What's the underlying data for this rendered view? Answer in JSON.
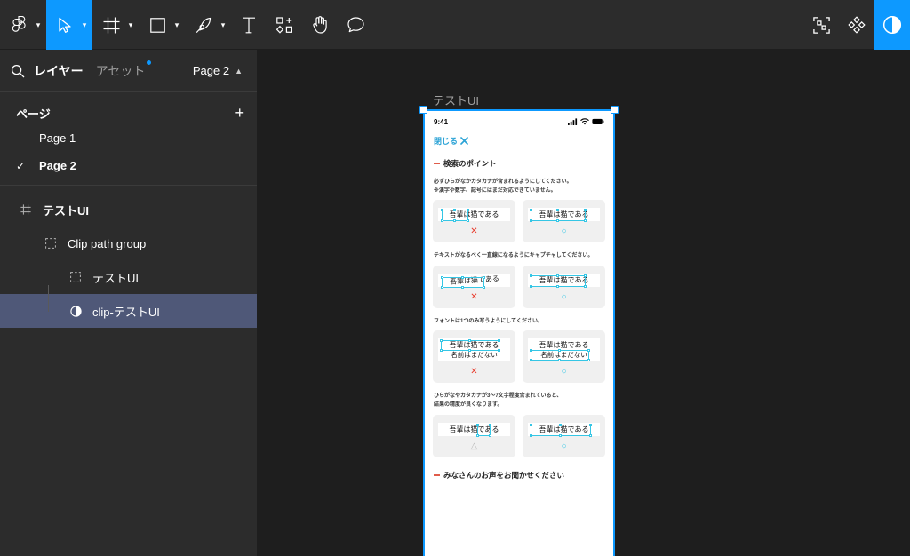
{
  "toolbar": {
    "tools": [
      {
        "name": "figma-logo-icon",
        "label": "Figma",
        "has_caret": true,
        "active": false
      },
      {
        "name": "move-tool-icon",
        "label": "移動",
        "has_caret": true,
        "active": true
      },
      {
        "name": "frame-tool-icon",
        "label": "フレーム",
        "has_caret": true,
        "active": false
      },
      {
        "name": "shape-tool-icon",
        "label": "シェイプ",
        "has_caret": true,
        "active": false
      },
      {
        "name": "pen-tool-icon",
        "label": "ペン",
        "has_caret": true,
        "active": false
      },
      {
        "name": "text-tool-icon",
        "label": "テキスト",
        "has_caret": false,
        "active": false
      },
      {
        "name": "components-tool-icon",
        "label": "コンポーネント",
        "has_caret": false,
        "active": false
      },
      {
        "name": "hand-tool-icon",
        "label": "手のひら",
        "has_caret": false,
        "active": false
      },
      {
        "name": "comment-tool-icon",
        "label": "コメント",
        "has_caret": false,
        "active": false
      }
    ],
    "right_tools": [
      {
        "name": "dev-mode-icon",
        "label": "開発モード",
        "active": false
      },
      {
        "name": "plugins-icon",
        "label": "プラグイン",
        "active": false
      },
      {
        "name": "appearance-icon",
        "label": "表示切替",
        "active": true
      }
    ]
  },
  "sidebar": {
    "search_icon": "search-icon",
    "tabs": [
      {
        "label": "レイヤー",
        "active": true,
        "badge": false
      },
      {
        "label": "アセット",
        "active": false,
        "badge": true
      }
    ],
    "page_selector": {
      "label": "Page 2",
      "chevron": "chevron-up-icon"
    },
    "pages_section": {
      "title": "ページ",
      "add_label": "+",
      "items": [
        {
          "label": "Page 1",
          "selected": false
        },
        {
          "label": "Page 2",
          "selected": true
        }
      ]
    },
    "layers": [
      {
        "label": "テストUI",
        "icon": "frame-icon",
        "indent": 0,
        "selected": false,
        "bold": true
      },
      {
        "label": "Clip path group",
        "icon": "group-icon",
        "indent": 1,
        "selected": false,
        "bold": false
      },
      {
        "label": "テストUI",
        "icon": "group-icon",
        "indent": 2,
        "selected": false,
        "bold": false
      },
      {
        "label": "clip-テストUI",
        "icon": "boolean-icon",
        "indent": 2,
        "selected": true,
        "bold": false
      }
    ]
  },
  "canvas": {
    "frame_title": "テストUI",
    "artboard": {
      "status_bar": {
        "time": "9:41",
        "signal_icon": "cellular-signal-icon",
        "wifi_icon": "wifi-icon",
        "battery_icon": "battery-icon"
      },
      "close_button": {
        "label": "閉じる",
        "icon": "close-icon"
      },
      "section_title": "検索のポイント",
      "sections": [
        {
          "description": "必ずひらがなかカタカナが含まれるようにしてください。\n※漢字や数字、記号にはまだ対応できていません。",
          "cards": [
            {
              "lines": [
                "吾輩は猫である"
              ],
              "verdict": "✕",
              "verdict_type": "ng",
              "style": "normal",
              "sel_width": 52
            },
            {
              "lines": [
                "吾輩は猫である"
              ],
              "verdict": "○",
              "verdict_type": "ok",
              "style": "normal",
              "sel_width": 62
            }
          ]
        },
        {
          "description": "テキストがなるべく一直線になるようにキャプチャしてください。",
          "cards": [
            {
              "lines": [
                "吾輩は猫である"
              ],
              "verdict": "✕",
              "verdict_type": "ng",
              "style": "skew",
              "sel_width": 52
            },
            {
              "lines": [
                "吾輩は猫である"
              ],
              "verdict": "○",
              "verdict_type": "ok",
              "style": "normal",
              "sel_width": 62
            }
          ]
        },
        {
          "description": "フォントは1つのみ写うようにしてください。",
          "cards": [
            {
              "lines": [
                "吾輩は猫である",
                "名前はまだない"
              ],
              "verdict": "✕",
              "verdict_type": "ng",
              "style": "two-line-top",
              "sel_width": 66
            },
            {
              "lines": [
                "吾輩は猫である",
                "名前はまだない"
              ],
              "verdict": "○",
              "verdict_type": "ok",
              "style": "two-line-bottom",
              "sel_width": 66
            }
          ]
        },
        {
          "description": "ひらがなやカタカナが3〜7文字程度含まれていると、\n結果の精度が良くなります。",
          "cards": [
            {
              "lines": [
                "吾輩は猫である"
              ],
              "verdict": "△",
              "verdict_type": "warn",
              "style": "partial",
              "sel_width": 16
            },
            {
              "lines": [
                "吾輩は猫である"
              ],
              "verdict": "○",
              "verdict_type": "ok",
              "style": "normal",
              "sel_width": 68
            }
          ]
        }
      ],
      "bottom_section_title": "みなさんのお声をお聞かせください"
    }
  },
  "colors": {
    "accent": "#0d99ff",
    "selection_row": "#4f5878",
    "text_selection": "#35c6e5",
    "ng": "#e8392a",
    "section_dash": "#e05c4a",
    "link": "#2ba3d6"
  }
}
